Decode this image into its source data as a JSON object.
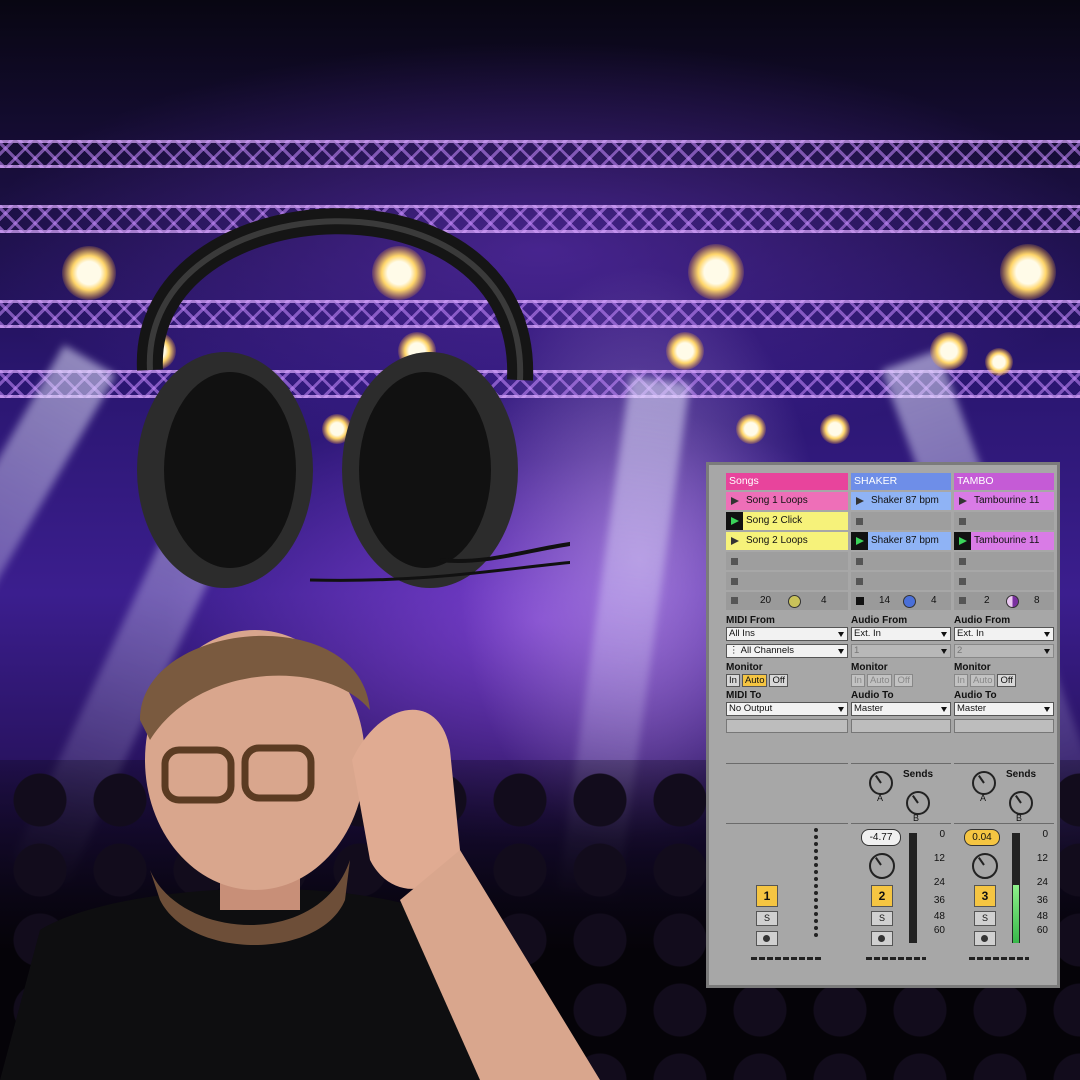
{
  "ableton": {
    "tracks": [
      {
        "name": "Songs",
        "header_color": "#e8449c",
        "clips": [
          {
            "label": "Song 1 Loops",
            "color": "#ee6fb8"
          },
          {
            "label": "Song 2 Click",
            "color": "#f6f27a"
          },
          {
            "label": "Song 2 Loops",
            "color": "#f6f27a"
          }
        ],
        "stats": {
          "left": "20",
          "right": "4"
        },
        "io": {
          "from_label": "MIDI From",
          "from_value": "All Ins",
          "channel_value": "All Channels",
          "monitor_label": "Monitor",
          "monitor": [
            "In",
            "Auto",
            "Off"
          ],
          "to_label": "MIDI To",
          "to_value": "No Output"
        },
        "track_number": "1",
        "solo": "S"
      },
      {
        "name": "SHAKER",
        "header_color": "#6e8ee8",
        "clips": [
          {
            "label": "Shaker 87 bpm",
            "color": "#8fb3f5"
          },
          {
            "label": "Shaker 87 bpm",
            "color": "#8fb3f5"
          }
        ],
        "stats": {
          "left": "14",
          "right": "4"
        },
        "io": {
          "from_label": "Audio From",
          "from_value": "Ext. In",
          "channel_value": "1",
          "monitor_label": "Monitor",
          "monitor": [
            "In",
            "Auto",
            "Off"
          ],
          "to_label": "Audio To",
          "to_value": "Master"
        },
        "sends_label": "Sends",
        "send_a": "A",
        "send_b": "B",
        "volume": "-4.77",
        "meter_scale": [
          "0",
          "12",
          "24",
          "36",
          "48",
          "60"
        ],
        "track_number": "2",
        "solo": "S"
      },
      {
        "name": "TAMBO",
        "header_color": "#c55bd6",
        "clips": [
          {
            "label": "Tambourine 11",
            "color": "#d97be6"
          },
          {
            "label": "Tambourine 11",
            "color": "#d97be6"
          }
        ],
        "stats": {
          "left": "2",
          "right": "8"
        },
        "io": {
          "from_label": "Audio From",
          "from_value": "Ext. In",
          "channel_value": "2",
          "monitor_label": "Monitor",
          "monitor": [
            "In",
            "Auto",
            "Off"
          ],
          "to_label": "Audio To",
          "to_value": "Master"
        },
        "sends_label": "Sends",
        "send_a": "A",
        "send_b": "B",
        "volume": "0.04",
        "meter_scale": [
          "0",
          "12",
          "24",
          "36",
          "48",
          "60"
        ],
        "track_number": "3",
        "solo": "S"
      }
    ]
  }
}
